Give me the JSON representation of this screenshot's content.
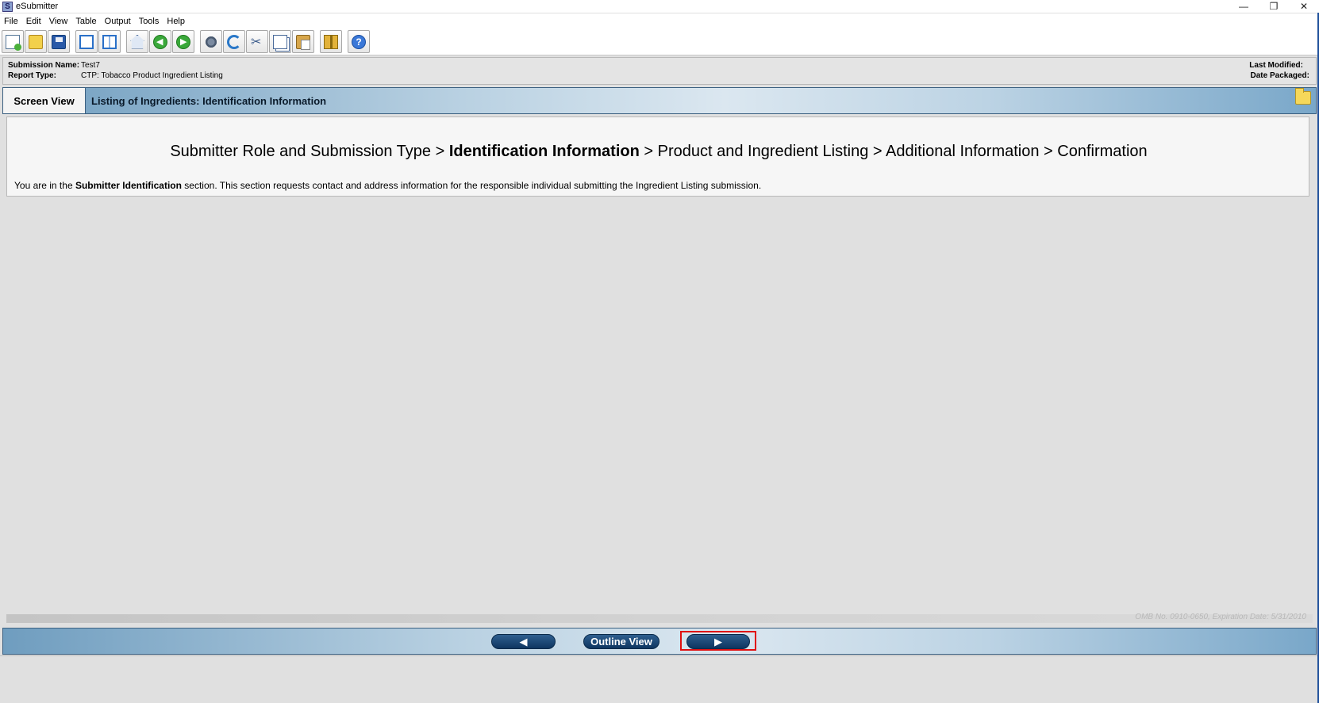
{
  "window": {
    "title": "eSubmitter",
    "app_icon_letter": "S",
    "controls": {
      "minimize": "—",
      "restore": "❐",
      "close": "✕"
    }
  },
  "menu": [
    "File",
    "Edit",
    "View",
    "Table",
    "Output",
    "Tools",
    "Help"
  ],
  "toolbar": {
    "icons": [
      "new-document-icon",
      "open-folder-icon",
      "save-icon",
      "single-window-icon",
      "split-window-icon",
      "home-icon",
      "back-arrow-icon",
      "forward-arrow-icon",
      "gears-icon",
      "refresh-icon",
      "cut-icon",
      "copy-icon",
      "paste-icon",
      "package-icon",
      "help-icon"
    ],
    "help_glyph": "?"
  },
  "info": {
    "submission_name_label": "Submission Name:",
    "submission_name_value": "Test7",
    "report_type_label": "Report Type:",
    "report_type_value": "CTP: Tobacco Product Ingredient Listing",
    "last_modified_label": "Last Modified:",
    "date_packaged_label": "Date Packaged:"
  },
  "header": {
    "tab_label": "Screen View",
    "title": "Listing of Ingredients: Identification Information"
  },
  "breadcrumb": {
    "step1": "Submitter Role and Submission Type",
    "sep1": " > ",
    "step2": "Identification Information",
    "sep2": " > ",
    "step3": "Product and Ingredient Listing",
    "sep3": " > ",
    "step4": "Additional Information",
    "sep4": " > ",
    "step5": "Confirmation"
  },
  "section": {
    "prefix": "You are in the ",
    "name": "Submitter Identification",
    "suffix": " section. This section requests contact and address information for the responsible individual submitting the Ingredient Listing submission."
  },
  "footer": {
    "omb_note": "OMB No. 0910-0650, Expiration Date: 5/31/2010"
  },
  "nav": {
    "prev_label": "◀",
    "outline_label": "Outline View",
    "next_label": "▶"
  },
  "colors": {
    "band_dark": "#6f9dbf",
    "band_light": "#dbe7f0",
    "nav_button": "#0e3560",
    "highlight": "#e01010"
  }
}
